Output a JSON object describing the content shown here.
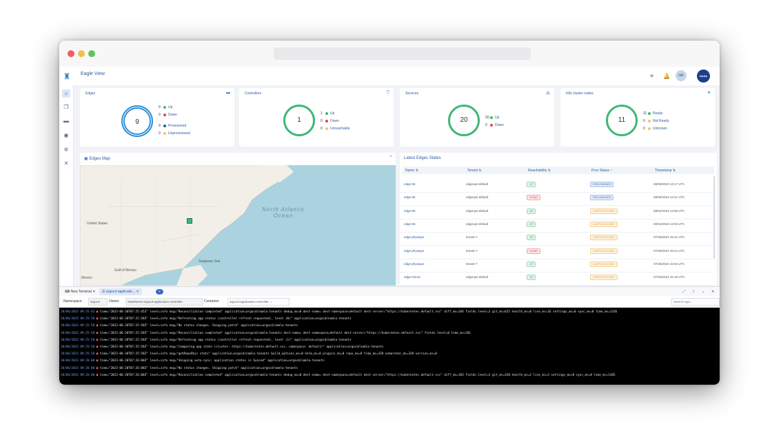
{
  "app": {
    "title": "Eagle View",
    "avatar": "GR",
    "org_logo": "NASA"
  },
  "sidebar": {
    "items": [
      "home-icon",
      "layers-icon",
      "router-icon",
      "gauge-icon",
      "cog-icon",
      "tools-icon"
    ]
  },
  "cards": [
    {
      "title": "Edges",
      "total": "9",
      "stats": [
        {
          "n": "9",
          "label": "Up",
          "color": "#3cb878"
        },
        {
          "n": "0",
          "label": "Down",
          "color": "#e84545"
        },
        {
          "n": "9",
          "label": "Provisioned",
          "color": "#2c5aa0"
        },
        {
          "n": "0",
          "label": "Unprovisioned",
          "color": "#f4c560"
        }
      ]
    },
    {
      "title": "Controllers",
      "total": "1",
      "stats": [
        {
          "n": "1",
          "label": "Up",
          "color": "#3cb878"
        },
        {
          "n": "0",
          "label": "Down",
          "color": "#e84545"
        },
        {
          "n": "0",
          "label": "Unreachable",
          "color": "#f4c560"
        }
      ]
    },
    {
      "title": "Services",
      "total": "20",
      "stats": [
        {
          "n": "20",
          "label": "Up",
          "color": "#3cb878"
        },
        {
          "n": "0",
          "label": "Down",
          "color": "#e84545"
        }
      ]
    },
    {
      "title": "K8s cluster nodes",
      "total": "11",
      "stats": [
        {
          "n": "11",
          "label": "Ready",
          "color": "#3cb878"
        },
        {
          "n": "0",
          "label": "Not Ready",
          "color": "#f4c560"
        },
        {
          "n": "0",
          "label": "Unknown",
          "color": "#f4c560"
        }
      ]
    }
  ],
  "map": {
    "title": "Edges Map",
    "labels": {
      "us": "United States",
      "ocean": "North Atlantic Ocean",
      "gulf": "Gulf of Mexico",
      "sargasso": "Sargasso Sea",
      "mexico": "Mexico"
    }
  },
  "edges_table": {
    "title": "Latest Edges States",
    "headers": [
      "Name",
      "Tenant",
      "Reachability",
      "Prov Status",
      "Timestamp"
    ],
    "rows": [
      {
        "name": "edge-55",
        "tenant": "edgeops-default",
        "reach": "UP",
        "prov": "PROVISIONED",
        "ts": "08/09/2023 13:17 UTC"
      },
      {
        "name": "edge-55",
        "tenant": "edgeops-default",
        "reach": "DOWN",
        "prov": "PROVISIONED",
        "ts": "08/09/2023 13:21 UTC"
      },
      {
        "name": "edge-55",
        "tenant": "edgeops-default",
        "reach": "UP",
        "prov": "UNPROVISIONED",
        "ts": "08/04/2023 13:08 UTC"
      },
      {
        "name": "edge-55",
        "tenant": "edgeops-default",
        "reach": "UP",
        "prov": "UNPROVISIONED",
        "ts": "08/04/2023 13:03 UTC"
      },
      {
        "name": "edge-physique",
        "tenant": "tenant-7",
        "reach": "UP",
        "prov": "UNPROVISIONED",
        "ts": "07/28/2023 15:41 UTC"
      },
      {
        "name": "edge-physique",
        "tenant": "tenant-7",
        "reach": "DOWN",
        "prov": "UNPROVISIONED",
        "ts": "07/28/2023 15:44 UTC"
      },
      {
        "name": "edge-physique",
        "tenant": "tenant-7",
        "reach": "UP",
        "prov": "UNPROVISIONED",
        "ts": "07/28/2023 15:50 UTC"
      },
      {
        "name": "edge-eivura",
        "tenant": "edgeops-default",
        "reach": "UP",
        "prov": "UNPROVISIONED",
        "ts": "07/25/2023 15:18 UTC"
      }
    ]
  },
  "terminal": {
    "tabs": [
      "New Terminal",
      "argocd-applicatio..."
    ],
    "namespace_label": "Namespace",
    "namespace": "argocd",
    "owner_label": "Owner",
    "owner": "StatefulSet argocd-application-controller",
    "container_label": "Container",
    "container": "argocd-application-controller",
    "search_placeholder": "Search logs...",
    "lines": [
      {
        "ts": "20/06/2023 09:25:45",
        "msg": "time=\"2023-06-20T07:25:45Z\" level=info msg=\"Reconciliation completed\" application=argocd/namla-tenants dedup_ms=0 dest-name= dest-namespace=default dest-server=\"https://kubernetes.default.svc\" diff_ms=164 fields.level=2 git_ms=625 health_ms=0 live_ms=16 settings_ms=0 sync_ms=0 time_ms=1326"
      },
      {
        "ts": "20/06/2023 09:25:58",
        "msg": "time=\"2023-06-20T07:25:58Z\" level=info msg=\"Refreshing app status (controller refresh requested), level (0)\" application=argocd/namla-tenants"
      },
      {
        "ts": "20/06/2023 09:25:58",
        "msg": "time=\"2023-06-20T07:25:58Z\" level=info msg=\"No status changes. Skipping patch\" application=argocd/namla-tenants"
      },
      {
        "ts": "20/06/2023 09:25:58",
        "msg": "time=\"2023-06-20T07:25:58Z\" level=info msg=\"Reconciliation completed\" application=argocd/namla-tenants dest-name= dest-namespace=default dest-server=\"https://kubernetes.default.svc\" fields.level=0 time_ms=101"
      },
      {
        "ts": "20/06/2023 09:25:58",
        "msg": "time=\"2023-06-20T07:25:58Z\" level=info msg=\"Refreshing app status (controller refresh requested), level (1)\" application=argocd/namla-tenants"
      },
      {
        "ts": "20/06/2023 09:25:58",
        "msg": "time=\"2023-06-20T07:25:58Z\" level=info msg=\"Comparing app state (cluster: https://kubernetes.default.svc, namespace: default)\" application=argocd/namla-tenants"
      },
      {
        "ts": "20/06/2023 09:25:58",
        "msg": "time=\"2023-06-20T07:25:58Z\" level=info msg=\"getRepoObjs stats\" application=argocd/namla-tenants build_options_ms=0 helm_ms=0 plugins_ms=0 repo_ms=0 time_ms=320 unmarshal_ms=320 version_ms=0"
      },
      {
        "ts": "20/06/2023 09:26:00",
        "msg": "time=\"2023-06-20T07:26:00Z\" level=info msg=\"Skipping auto-sync: application status is Synced\" application=argocd/namla-tenants"
      },
      {
        "ts": "20/06/2023 09:26:00",
        "msg": "time=\"2023-06-20T07:26:00Z\" level=info msg=\"No status changes. Skipping patch\" application=argocd/namla-tenants"
      },
      {
        "ts": "20/06/2023 09:26:00",
        "msg": "time=\"2023-06-20T07:26:00Z\" level=info msg=\"Reconciliation completed\" application=argocd/namla-tenants dedup_ms=0 dest-name= dest-namespace=default dest-server=\"https://kubernetes.default.svc\" diff_ms=103 fields.level=2 git_ms=320 health_ms=2 live_ms=3 settings_ms=0 sync_ms=0 time_ms=1305"
      }
    ]
  }
}
